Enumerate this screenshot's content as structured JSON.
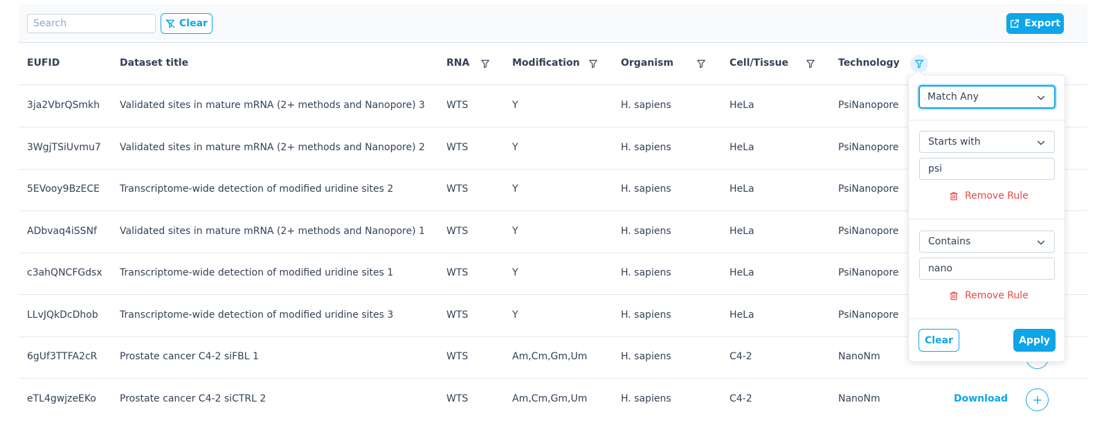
{
  "toolbar": {
    "search_placeholder": "Search",
    "clear_label": "Clear",
    "export_label": "Export"
  },
  "columns": {
    "eufid": "EUFID",
    "title": "Dataset title",
    "rna": "RNA",
    "modification": "Modification",
    "organism": "Organism",
    "cell": "Cell/Tissue",
    "technology": "Technology"
  },
  "rows": [
    {
      "eufid": "3ja2VbrQSmkh",
      "title": "Validated sites in mature mRNA (2+ methods and Nanopore) 3",
      "rna": "WTS",
      "modification": "Y",
      "organism": "H. sapiens",
      "cell": "HeLa",
      "technology": "PsiNanopore"
    },
    {
      "eufid": "3WgjTSiUvmu7",
      "title": "Validated sites in mature mRNA (2+ methods and Nanopore) 2",
      "rna": "WTS",
      "modification": "Y",
      "organism": "H. sapiens",
      "cell": "HeLa",
      "technology": "PsiNanopore"
    },
    {
      "eufid": "5EVooy9BzECE",
      "title": "Transcriptome-wide detection of modified uridine sites 2",
      "rna": "WTS",
      "modification": "Y",
      "organism": "H. sapiens",
      "cell": "HeLa",
      "technology": "PsiNanopore"
    },
    {
      "eufid": "ADbvaq4iSSNf",
      "title": "Validated sites in mature mRNA (2+ methods and Nanopore) 1",
      "rna": "WTS",
      "modification": "Y",
      "organism": "H. sapiens",
      "cell": "HeLa",
      "technology": "PsiNanopore"
    },
    {
      "eufid": "c3ahQNCFGdsx",
      "title": "Transcriptome-wide detection of modified uridine sites 1",
      "rna": "WTS",
      "modification": "Y",
      "organism": "H. sapiens",
      "cell": "HeLa",
      "technology": "PsiNanopore"
    },
    {
      "eufid": "LLvJQkDcDhob",
      "title": "Transcriptome-wide detection of modified uridine sites 3",
      "rna": "WTS",
      "modification": "Y",
      "organism": "H. sapiens",
      "cell": "HeLa",
      "technology": "PsiNanopore"
    },
    {
      "eufid": "6gUf3TTFA2cR",
      "title": "Prostate cancer C4-2 siFBL 1",
      "rna": "WTS",
      "modification": "Am,Cm,Gm,Um",
      "organism": "H. sapiens",
      "cell": "C4-2",
      "technology": "NanoNm"
    },
    {
      "eufid": "eTL4gwjzeEKo",
      "title": "Prostate cancer C4-2 siCTRL 2",
      "rna": "WTS",
      "modification": "Am,Cm,Gm,Um",
      "organism": "H. sapiens",
      "cell": "C4-2",
      "technology": "NanoNm",
      "download": "Download"
    }
  ],
  "filter_panel": {
    "operator": "Match Any",
    "rules": [
      {
        "match_mode": "Starts with",
        "value": "psi",
        "remove_label": "Remove Rule"
      },
      {
        "match_mode": "Contains",
        "value": "nano",
        "remove_label": "Remove Rule"
      }
    ],
    "clear_label": "Clear",
    "apply_label": "Apply"
  },
  "colors": {
    "accent": "#0ea5e9",
    "danger": "#ef4444",
    "text": "#334155",
    "border": "#e2e8f0"
  },
  "icons": {
    "clear": "filter-slash-icon",
    "export": "external-link-icon",
    "column_filter": "filter-icon",
    "remove_rule": "trash-icon",
    "dropdown": "chevron-down-icon",
    "add": "plus-icon"
  }
}
